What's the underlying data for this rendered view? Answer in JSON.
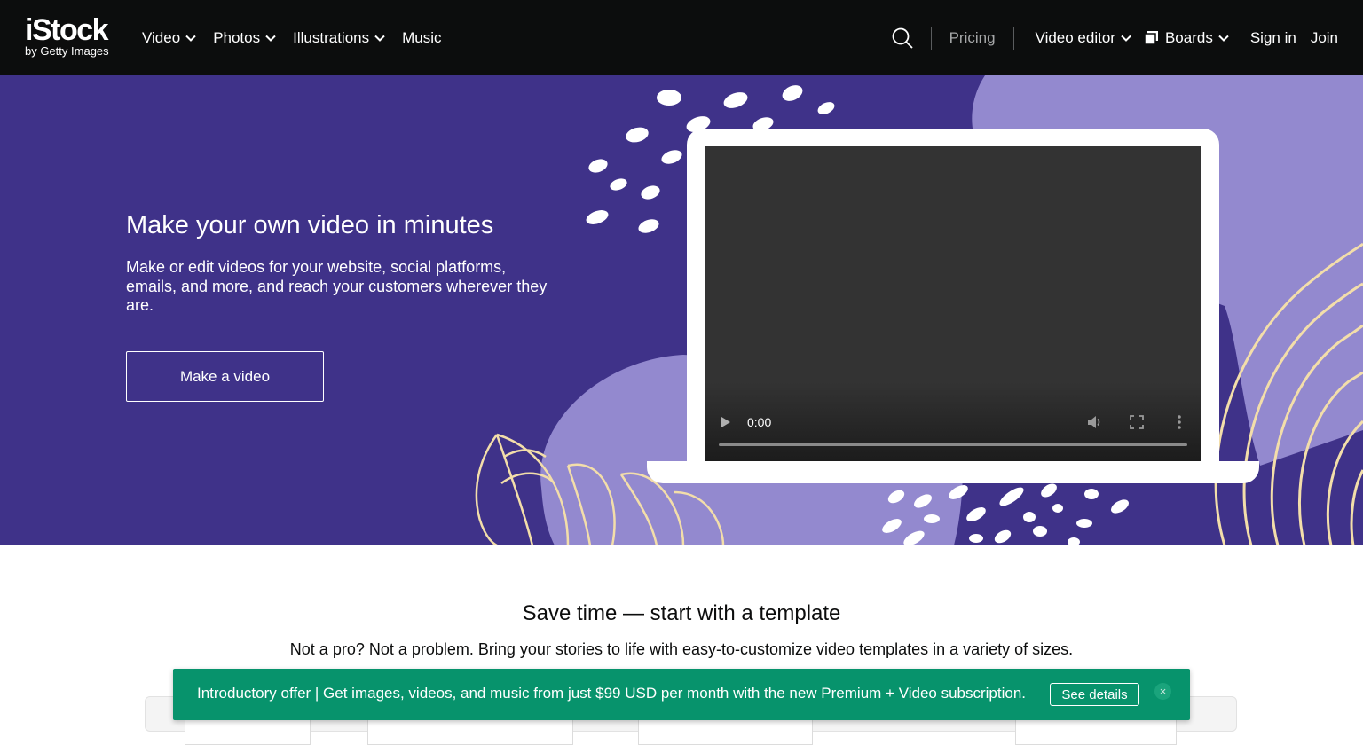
{
  "header": {
    "logo_main": "iStock",
    "logo_sub": "by Getty Images",
    "nav_left": [
      {
        "label": "Video"
      },
      {
        "label": "Photos"
      },
      {
        "label": "Illustrations"
      },
      {
        "label": "Music"
      }
    ],
    "pricing": "Pricing",
    "video_editor": "Video editor",
    "boards": "Boards",
    "sign_in": "Sign in",
    "join": "Join"
  },
  "hero": {
    "title": "Make your own video in minutes",
    "subtitle": "Make or edit videos for your website, social platforms, emails, and more, and reach your customers wherever they are.",
    "cta": "Make a video",
    "video": {
      "current_time": "0:00",
      "progress": 0
    }
  },
  "templates": {
    "title": "Save time — start with a template",
    "subtitle": "Not a pro? Not a problem. Bring your stories to life with easy-to-customize video templates in a variety of sizes."
  },
  "promo": {
    "text": "Introductory offer | Get images, videos, and music from just $99 USD per month with the new Premium + Video subscription.",
    "button": "See details",
    "close": "×"
  },
  "colors": {
    "nav_bg": "#0c0d0d",
    "hero_bg": "#3f3289",
    "hero_shape": "#9389cf",
    "hero_line": "#f3deaa",
    "promo_bg": "#07936c"
  },
  "icons": [
    "search-icon",
    "chevron-down-icon",
    "boards-icon",
    "play-icon",
    "volume-icon",
    "fullscreen-icon",
    "more-vert-icon",
    "close-icon"
  ]
}
